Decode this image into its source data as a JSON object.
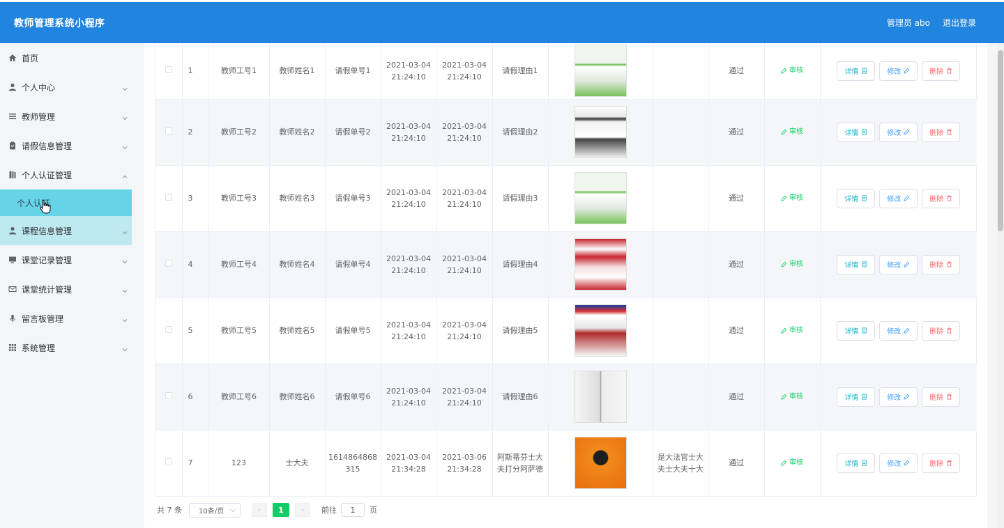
{
  "app": {
    "title": "教师管理系统小程序"
  },
  "header": {
    "user_label": "管理员 abo",
    "logout_label": "退出登录"
  },
  "sidebar": {
    "items": [
      {
        "label": "首页",
        "icon": "home-icon"
      },
      {
        "label": "个人中心",
        "icon": "user-icon"
      },
      {
        "label": "教师管理",
        "icon": "list-icon"
      },
      {
        "label": "请假信息管理",
        "icon": "clipboard-icon"
      },
      {
        "label": "个人认证管理",
        "icon": "notebook-icon"
      },
      {
        "label": "个人认证",
        "icon": ""
      },
      {
        "label": "课程信息管理",
        "icon": "user-icon"
      },
      {
        "label": "课堂记录管理",
        "icon": "monitor-icon"
      },
      {
        "label": "课堂统计管理",
        "icon": "mail-icon"
      },
      {
        "label": "留言板管理",
        "icon": "microphone-icon"
      },
      {
        "label": "系统管理",
        "icon": "grid-icon"
      }
    ]
  },
  "table": {
    "rows": [
      {
        "index": "1",
        "teacher_id": "教师工号1",
        "teacher_name": "教师姓名1",
        "leave_no": "请假单号1",
        "start_date": "2021-03-04",
        "start_time": "21:24:10",
        "end_date": "2021-03-04",
        "end_time": "21:24:10",
        "reason": "请假理由1",
        "remark": "",
        "status": "通过"
      },
      {
        "index": "2",
        "teacher_id": "教师工号2",
        "teacher_name": "教师姓名2",
        "leave_no": "请假单号2",
        "start_date": "2021-03-04",
        "start_time": "21:24:10",
        "end_date": "2021-03-04",
        "end_time": "21:24:10",
        "reason": "请假理由2",
        "remark": "",
        "status": "通过"
      },
      {
        "index": "3",
        "teacher_id": "教师工号3",
        "teacher_name": "教师姓名3",
        "leave_no": "请假单号3",
        "start_date": "2021-03-04",
        "start_time": "21:24:10",
        "end_date": "2021-03-04",
        "end_time": "21:24:10",
        "reason": "请假理由3",
        "remark": "",
        "status": "通过"
      },
      {
        "index": "4",
        "teacher_id": "教师工号4",
        "teacher_name": "教师姓名4",
        "leave_no": "请假单号4",
        "start_date": "2021-03-04",
        "start_time": "21:24:10",
        "end_date": "2021-03-04",
        "end_time": "21:24:10",
        "reason": "请假理由4",
        "remark": "",
        "status": "通过"
      },
      {
        "index": "5",
        "teacher_id": "教师工号5",
        "teacher_name": "教师姓名5",
        "leave_no": "请假单号5",
        "start_date": "2021-03-04",
        "start_time": "21:24:10",
        "end_date": "2021-03-04",
        "end_time": "21:24:10",
        "reason": "请假理由5",
        "remark": "",
        "status": "通过"
      },
      {
        "index": "6",
        "teacher_id": "教师工号6",
        "teacher_name": "教师姓名6",
        "leave_no": "请假单号6",
        "start_date": "2021-03-04",
        "start_time": "21:24:10",
        "end_date": "2021-03-04",
        "end_time": "21:24:10",
        "reason": "请假理由6",
        "remark": "",
        "status": "通过"
      },
      {
        "index": "7",
        "teacher_id": "123",
        "teacher_name": "士大夫",
        "leave_no": "1614864868315",
        "start_date": "2021-03-04",
        "start_time": "21:34:28",
        "end_date": "2021-03-06",
        "end_time": "21:34:28",
        "reason": "阿斯蒂芬士大夫打分阿萨德",
        "remark": "是大法官士大夫士大夫十大",
        "status": "通过"
      }
    ],
    "actions": {
      "audit": "审核",
      "detail": "详情",
      "edit": "修改",
      "delete": "删除"
    }
  },
  "pagination": {
    "total": "共 7 条",
    "page_size": "10条/页",
    "current_page": "1",
    "goto_prefix": "前往",
    "goto_value": "1",
    "goto_suffix": "页",
    "prev_glyph": "‹",
    "next_glyph": "›"
  },
  "colors": {
    "header": "#2185e0",
    "active_submenu": "#66d4e6",
    "success": "#13ce66",
    "danger": "#f56c6c",
    "primary": "#409eff"
  }
}
